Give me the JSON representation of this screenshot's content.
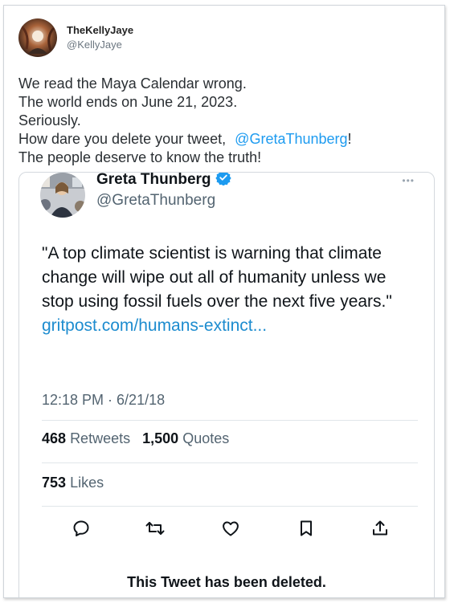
{
  "tweet": {
    "author_name": "TheKellyJaye",
    "author_handle": "@KellyJaye",
    "lines": [
      "We read the Maya Calendar wrong.",
      "The world ends on June 21, 2023.",
      "Seriously.",
      "How dare you delete your tweet,",
      "The people deserve to know the truth!"
    ],
    "mention": "@GretaThunberg",
    "mention_suffix": "!"
  },
  "quoted": {
    "author_name": "Greta Thunberg",
    "author_handle": "@GretaThunberg",
    "more": "•••",
    "text": "\"A top climate scientist is warning that climate change will wipe out all of humanity unless we stop using fossil fuels over the next five years.\"",
    "link": "gritpost.com/humans-extinct...",
    "timestamp": "12:18 PM · 6/21/18",
    "retweets_count": "468",
    "retweets_label": "Retweets",
    "quotes_count": "1,500",
    "quotes_label": "Quotes",
    "likes_count": "753",
    "likes_label": "Likes",
    "deleted_notice": "This Tweet has been deleted."
  },
  "icons": {
    "reply": "reply-icon",
    "retweet": "retweet-icon",
    "like": "heart-icon",
    "bookmark": "bookmark-icon",
    "share": "share-icon",
    "verified": "verified-badge-icon"
  },
  "colors": {
    "link": "#1d9bf0",
    "verified": "#1d9bf0",
    "text": "#0f1419",
    "muted": "#536471"
  }
}
